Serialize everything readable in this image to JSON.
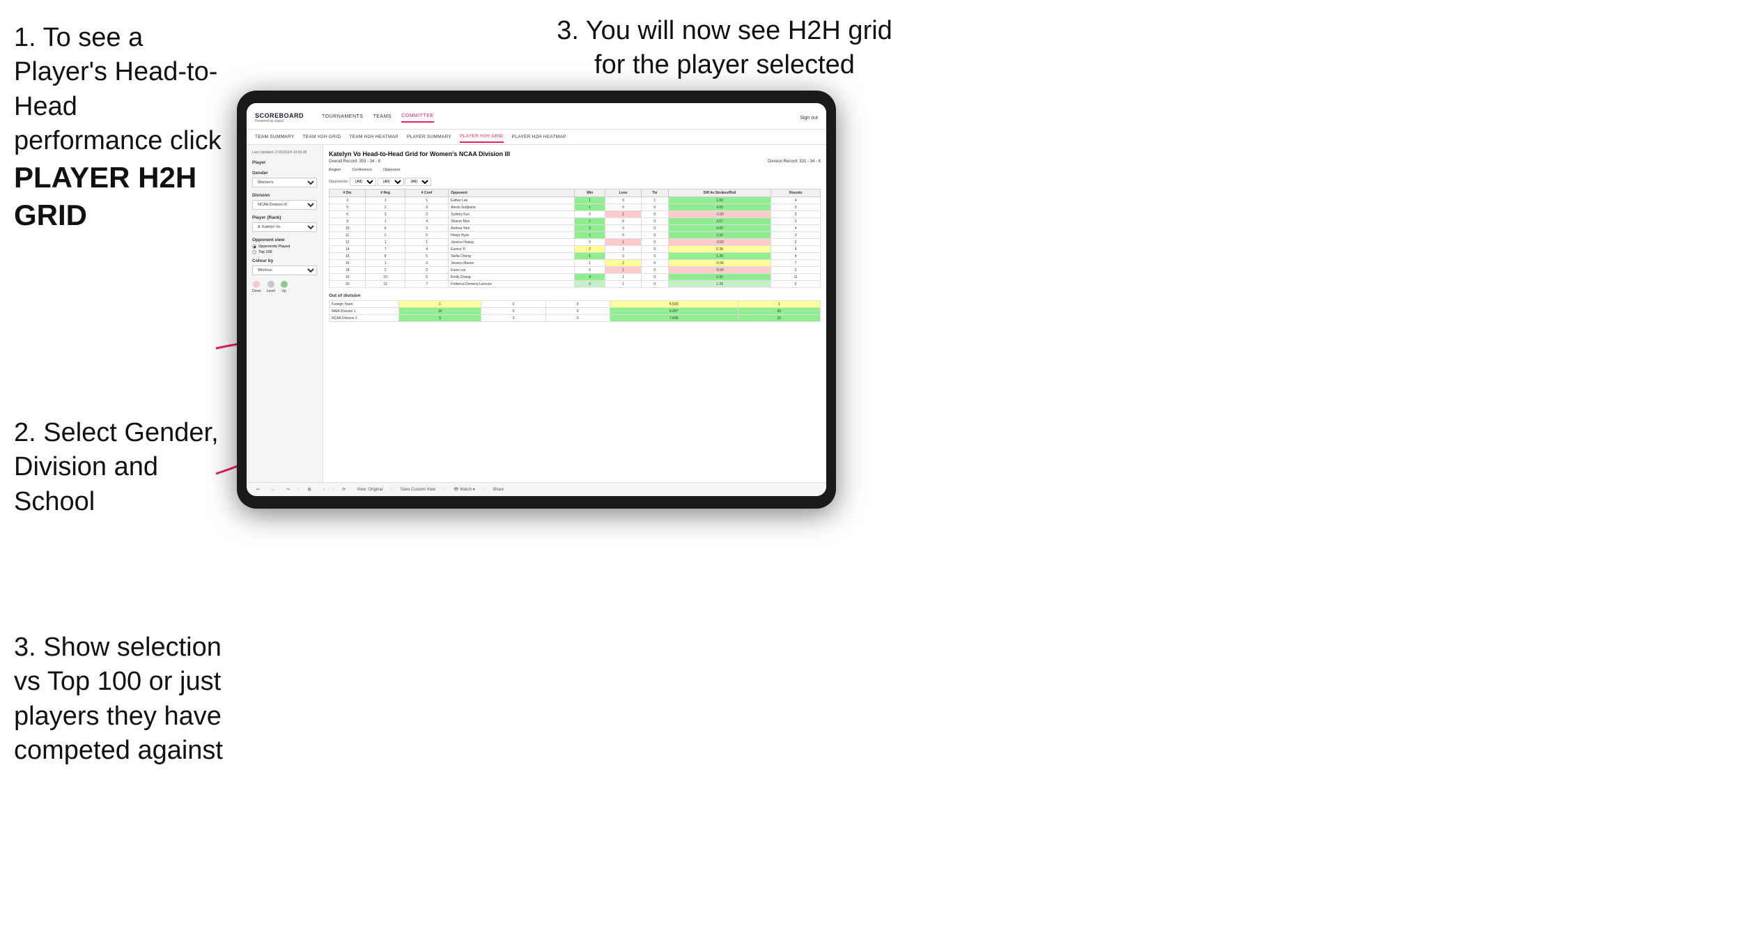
{
  "instructions": {
    "step1_title": "1. To see a Player's Head-to-Head performance click",
    "step1_bold": "PLAYER H2H GRID",
    "step2_title": "2. Select Gender, Division and School",
    "step3_left_title": "3. Show selection vs Top 100 or just players they have competed against",
    "step3_right_title": "3. You will now see H2H grid for the player selected"
  },
  "nav": {
    "logo": "SCOREBOARD",
    "logo_sub": "Powered by clippd",
    "links": [
      "TOURNAMENTS",
      "TEAMS",
      "COMMITTEE"
    ],
    "active_link": "COMMITTEE",
    "sign_in": "Sign out"
  },
  "sub_nav": {
    "links": [
      "TEAM SUMMARY",
      "TEAM H2H GRID",
      "TEAM H2H HEATMAP",
      "PLAYER SUMMARY",
      "PLAYER H2H GRID",
      "PLAYER H2H HEATMAP"
    ],
    "active": "PLAYER H2H GRID"
  },
  "sidebar": {
    "timestamp": "Last Updated: 27/03/2024 16:55:38",
    "player_label": "Player",
    "gender_label": "Gender",
    "gender_value": "Women's",
    "division_label": "Division",
    "division_value": "NCAA Division III",
    "player_rank_label": "Player (Rank)",
    "player_rank_value": "8. Katelyn Vo",
    "opponent_view_label": "Opponent view",
    "opponent_options": [
      "Opponents Played",
      "Top 100"
    ],
    "selected_option": "Opponents Played",
    "colour_label": "Colour by",
    "colour_value": "Win/loss",
    "legend": [
      {
        "label": "Down",
        "color": "#f8c8c8"
      },
      {
        "label": "Level",
        "color": "#c8c8c8"
      },
      {
        "label": "Up",
        "color": "#90c890"
      }
    ]
  },
  "grid": {
    "title": "Katelyn Vo Head-to-Head Grid for Women's NCAA Division III",
    "overall_record": "Overall Record: 353 - 34 - 6",
    "division_record": "Division Record: 331 - 34 - 6",
    "region_label": "Region",
    "conference_label": "Conference",
    "opponent_label": "Opponent",
    "opponents_label": "Opponents:",
    "all_value": "(All)",
    "columns": [
      "# Div",
      "# Reg",
      "# Conf",
      "Opponent",
      "Win",
      "Loss",
      "Tie",
      "Diff Av Strokes/Rnd",
      "Rounds"
    ],
    "rows": [
      {
        "div": 3,
        "reg": 1,
        "conf": 1,
        "opponent": "Esther Lee",
        "win": 1,
        "loss": 0,
        "tie": 1,
        "diff": "1.50",
        "rounds": 4,
        "win_color": "green",
        "loss_color": "none"
      },
      {
        "div": 5,
        "reg": 2,
        "conf": 2,
        "opponent": "Alexis Sudjianto",
        "win": 1,
        "loss": 0,
        "tie": 0,
        "diff": "4.00",
        "rounds": 3,
        "win_color": "green"
      },
      {
        "div": 6,
        "reg": 3,
        "conf": 3,
        "opponent": "Sydney Kuo",
        "win": 0,
        "loss": 1,
        "tie": 0,
        "diff": "-1.00",
        "rounds": 3,
        "loss_color": "red"
      },
      {
        "div": 9,
        "reg": 1,
        "conf": 4,
        "opponent": "Sharon Mun",
        "win": 1,
        "loss": 0,
        "tie": 0,
        "diff": "3.67",
        "rounds": 3,
        "win_color": "green"
      },
      {
        "div": 10,
        "reg": 6,
        "conf": 3,
        "opponent": "Andrea York",
        "win": 2,
        "loss": 0,
        "tie": 0,
        "diff": "4.00",
        "rounds": 4,
        "win_color": "green"
      },
      {
        "div": 11,
        "reg": 2,
        "conf": 5,
        "opponent": "Heejo Hyun",
        "win": 1,
        "loss": 0,
        "tie": 0,
        "diff": "3.33",
        "rounds": 3,
        "win_color": "green"
      },
      {
        "div": 13,
        "reg": 1,
        "conf": 1,
        "opponent": "Jessica Huang",
        "win": 0,
        "loss": 1,
        "tie": 0,
        "diff": "-3.00",
        "rounds": 2,
        "loss_color": "red"
      },
      {
        "div": 14,
        "reg": 7,
        "conf": 4,
        "opponent": "Eunice Yi",
        "win": 2,
        "loss": 2,
        "tie": 0,
        "diff": "0.38",
        "rounds": 9,
        "win_color": "yellow"
      },
      {
        "div": 15,
        "reg": 8,
        "conf": 5,
        "opponent": "Stella Cheng",
        "win": 1,
        "loss": 0,
        "tie": 0,
        "diff": "1.25",
        "rounds": 4,
        "win_color": "green"
      },
      {
        "div": 16,
        "reg": 1,
        "conf": 3,
        "opponent": "Jessica Mason",
        "win": 1,
        "loss": 2,
        "tie": 0,
        "diff": "-0.94",
        "rounds": 7,
        "loss_color": "yellow"
      },
      {
        "div": 18,
        "reg": 2,
        "conf": 2,
        "opponent": "Euna Lee",
        "win": 0,
        "loss": 1,
        "tie": 0,
        "diff": "-5.00",
        "rounds": 2,
        "loss_color": "red"
      },
      {
        "div": 19,
        "reg": 10,
        "conf": 6,
        "opponent": "Emily Chang",
        "win": 4,
        "loss": 1,
        "tie": 0,
        "diff": "0.30",
        "rounds": 11,
        "win_color": "green"
      },
      {
        "div": 20,
        "reg": 11,
        "conf": 7,
        "opponent": "Federica Domecq Lacroze",
        "win": 2,
        "loss": 1,
        "tie": 0,
        "diff": "1.33",
        "rounds": 6,
        "win_color": "light-green"
      }
    ],
    "out_of_division_label": "Out of division",
    "out_of_division_rows": [
      {
        "name": "Foreign Team",
        "win": 1,
        "loss": 0,
        "tie": 0,
        "diff": "4.500",
        "rounds": 2,
        "color": "yellow"
      },
      {
        "name": "NAIA Division 1",
        "win": 15,
        "loss": 0,
        "tie": 0,
        "diff": "9.267",
        "rounds": 30,
        "color": "green"
      },
      {
        "name": "NCAA Division 2",
        "win": 5,
        "loss": 0,
        "tie": 0,
        "diff": "7.400",
        "rounds": 10,
        "color": "green"
      }
    ]
  },
  "toolbar": {
    "buttons": [
      "↩",
      "←",
      "↪",
      "⊞",
      "↓",
      "·",
      "⟳",
      "⊙",
      "View: Original",
      "Save Custom View",
      "👁 Watch",
      "↗",
      "↔",
      "Share"
    ]
  }
}
